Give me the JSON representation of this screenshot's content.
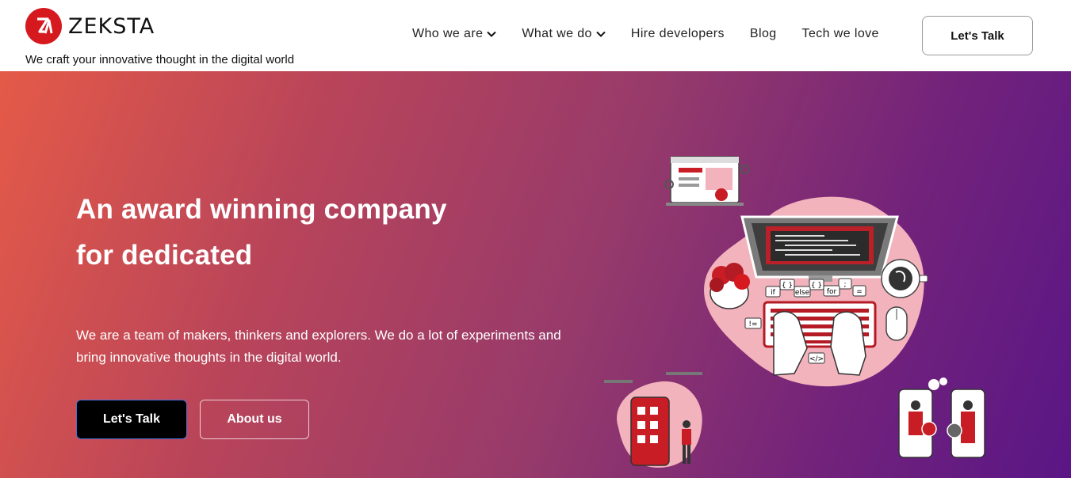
{
  "brand": {
    "name": "ZEKSTA",
    "tagline": "We craft your innovative thought in the digital world",
    "accent": "#d5191f"
  },
  "nav": {
    "items": [
      {
        "label": "Who we are",
        "has_dropdown": true
      },
      {
        "label": "What we do",
        "has_dropdown": true
      },
      {
        "label": "Hire developers",
        "has_dropdown": false
      },
      {
        "label": "Blog",
        "has_dropdown": false
      },
      {
        "label": "Tech we love",
        "has_dropdown": false
      }
    ],
    "cta_label": "Let's Talk"
  },
  "hero": {
    "title_line1": "An award winning company",
    "title_line2": "for dedicated",
    "description": "We are a team of makers, thinkers and explorers. We do a lot of experiments and bring innovative thoughts in the digital world.",
    "primary_button": "Let's Talk",
    "secondary_button": "About us",
    "gradient_start": "#e45a48",
    "gradient_end": "#5a1686"
  },
  "illustration": {
    "code_tags": [
      "if",
      "{ }",
      "{ }",
      ";",
      "else",
      "for",
      "=",
      "!=",
      "</>"
    ]
  }
}
